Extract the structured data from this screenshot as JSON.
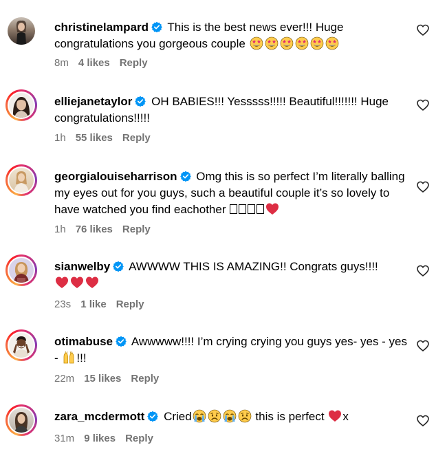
{
  "comments": [
    {
      "username": "christinelampard",
      "verified": true,
      "text": "This is the best news ever!!! Huge congratulations you gorgeous couple",
      "emojis": [
        "star-struck",
        "star-struck",
        "star-struck",
        "star-struck",
        "star-struck",
        "star-struck"
      ],
      "time": "8m",
      "likes": "4 likes",
      "reply": "Reply",
      "story_ring": false
    },
    {
      "username": "elliejanetaylor",
      "verified": true,
      "text": "OH BABIES!!! Yesssss!!!!! Beautiful!!!!!!! Huge congratulations!!!!!",
      "time": "1h",
      "likes": "55 likes",
      "reply": "Reply",
      "story_ring": true
    },
    {
      "username": "georgialouiseharrison",
      "verified": true,
      "text": "Omg this is so perfect I’m literally balling my eyes out for you guys, such a beautiful couple it’s so lovely to have watched you find eachother",
      "time": "1h",
      "likes": "76 likes",
      "reply": "Reply",
      "story_ring": true
    },
    {
      "username": "sianwelby",
      "verified": true,
      "text": "AWWWW THIS IS AMAZING!! Congrats guys!!!!",
      "time": "23s",
      "likes": "1 like",
      "reply": "Reply",
      "story_ring": true
    },
    {
      "username": "otimabuse",
      "verified": true,
      "text_a": "Awwwww!!!! I’m crying crying you guys yes- yes - yes -",
      "text_b": "!!!",
      "time": "22m",
      "likes": "15 likes",
      "reply": "Reply",
      "story_ring": true
    },
    {
      "username": "zara_mcdermott",
      "verified": true,
      "text_a": "Cried",
      "text_b": "this is perfect",
      "text_c": "x",
      "time": "31m",
      "likes": "9 likes",
      "reply": "Reply",
      "story_ring": true
    }
  ],
  "colors": {
    "verified_blue": "#0095f6",
    "meta_grey": "#737373",
    "heart_red": "#e0245e"
  }
}
